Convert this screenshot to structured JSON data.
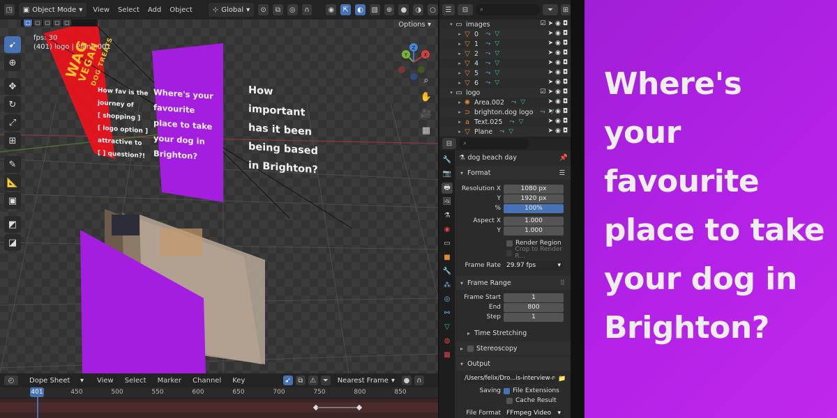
{
  "viewport": {
    "header": {
      "mode": "Object Mode",
      "menus": [
        "View",
        "Select",
        "Add",
        "Object"
      ],
      "transform_orientation": "Global"
    },
    "options_label": "Options",
    "info": {
      "fps": "fps: 30",
      "object": "(401) logo | Plane.001"
    },
    "plane_texts": {
      "red_logo_1": "WAG",
      "red_logo_2": "VEGAN",
      "red_logo_3": "DOG TREATS",
      "left_question": [
        "How fav is the",
        "journey of",
        "[ shopping ]",
        "[ logo option ]",
        "attractive to",
        "[ ] question?!"
      ],
      "purple_question": [
        "Where's your",
        "favourite",
        "place to take",
        "your dog in",
        "Brighton?"
      ],
      "floating_question": [
        "How",
        "important",
        "has it been",
        "being based",
        "in Brighton?"
      ]
    }
  },
  "dope_sheet": {
    "editor": "Dope Sheet",
    "menus": [
      "View",
      "Select",
      "Marker",
      "Channel",
      "Key"
    ],
    "snap": "Nearest Frame",
    "current_frame": "401",
    "frame_labels": [
      "450",
      "500",
      "550",
      "600",
      "650",
      "700",
      "750",
      "800",
      "850"
    ]
  },
  "outliner": {
    "rows": [
      {
        "name": "images",
        "type": "collection"
      },
      {
        "name": "0",
        "type": "object"
      },
      {
        "name": "1",
        "type": "object"
      },
      {
        "name": "2",
        "type": "object"
      },
      {
        "name": "4",
        "type": "object"
      },
      {
        "name": "5",
        "type": "object"
      },
      {
        "name": "6",
        "type": "object"
      },
      {
        "name": "logo",
        "type": "collection"
      },
      {
        "name": "Area.002",
        "type": "light"
      },
      {
        "name": "brighton.dog logo",
        "type": "curve"
      },
      {
        "name": "Text.025",
        "type": "text"
      },
      {
        "name": "Plane",
        "type": "object"
      }
    ]
  },
  "properties": {
    "scene_name": "dog beach day",
    "format": {
      "title": "Format",
      "resolution_x_label": "Resolution X",
      "resolution_x": "1080 px",
      "resolution_y_label": "Y",
      "resolution_y": "1920 px",
      "percent_label": "%",
      "percent": "100%",
      "aspect_x_label": "Aspect X",
      "aspect_x": "1.000",
      "aspect_y_label": "Y",
      "aspect_y": "1.000",
      "render_region": "Render Region",
      "crop": "Crop to Render R...",
      "frame_rate_label": "Frame Rate",
      "frame_rate": "29.97 fps"
    },
    "frame_range": {
      "title": "Frame Range",
      "start_label": "Frame Start",
      "start": "1",
      "end_label": "End",
      "end": "800",
      "step_label": "Step",
      "step": "1"
    },
    "time_stretching": "Time Stretching",
    "stereoscopy": "Stereoscopy",
    "output": {
      "title": "Output",
      "path": "/Users/felix/Dro...is-interview-reel",
      "saving_label": "Saving",
      "file_extensions": "File Extensions",
      "cache_result": "Cache Result",
      "file_format_label": "File Format",
      "file_format": "FFmpeg Video"
    }
  },
  "card": {
    "lines": [
      "Where's your",
      "favourite",
      "place to take",
      "your dog in",
      "Brighton?"
    ]
  },
  "colors": {
    "accent_blue": "#4772b3",
    "card_purple": "#b221e6",
    "plane_purple": "#a41ee0",
    "plane_red": "#e8141e"
  }
}
